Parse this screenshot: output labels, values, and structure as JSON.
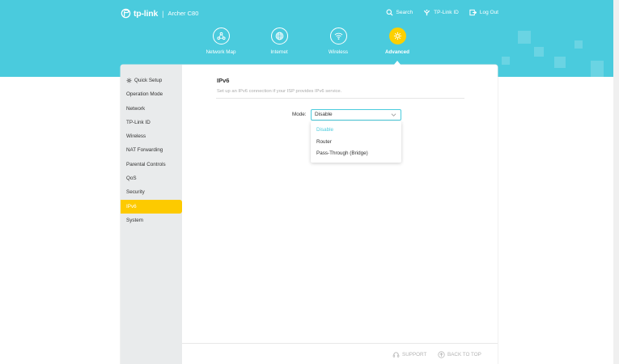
{
  "brand": {
    "logo_text": "tp-link",
    "separator": "|",
    "model": "Archer C80"
  },
  "top_links": {
    "search": "Search",
    "tplink_id": "TP-Link ID",
    "logout": "Log Out"
  },
  "nav": {
    "items": [
      {
        "label": "Network Map",
        "icon": "network-map-icon"
      },
      {
        "label": "Internet",
        "icon": "globe-icon"
      },
      {
        "label": "Wireless",
        "icon": "wifi-icon"
      },
      {
        "label": "Advanced",
        "icon": "gear-icon",
        "active": true
      }
    ]
  },
  "sidebar": {
    "items": [
      {
        "label": "Quick Setup",
        "icon": "gear-icon"
      },
      {
        "label": "Operation Mode"
      },
      {
        "label": "Network"
      },
      {
        "label": "TP-Link ID"
      },
      {
        "label": "Wireless"
      },
      {
        "label": "NAT Forwarding"
      },
      {
        "label": "Parental Controls"
      },
      {
        "label": "QoS"
      },
      {
        "label": "Security"
      },
      {
        "label": "IPv6",
        "active": true
      },
      {
        "label": "System"
      }
    ]
  },
  "page": {
    "title": "IPv6",
    "subtitle": "Set up an IPv6 connection if your ISP provides IPv6 service."
  },
  "mode": {
    "label": "Mode:",
    "value": "Disable",
    "options": [
      "Disable",
      "Router",
      "Pass-Through (Bridge)"
    ]
  },
  "footer": {
    "support": "SUPPORT",
    "back_to_top": "BACK TO TOP"
  },
  "colors": {
    "header": "#4acbdd",
    "accent": "#fdca00",
    "sidebar_bg": "#e9ebec"
  }
}
